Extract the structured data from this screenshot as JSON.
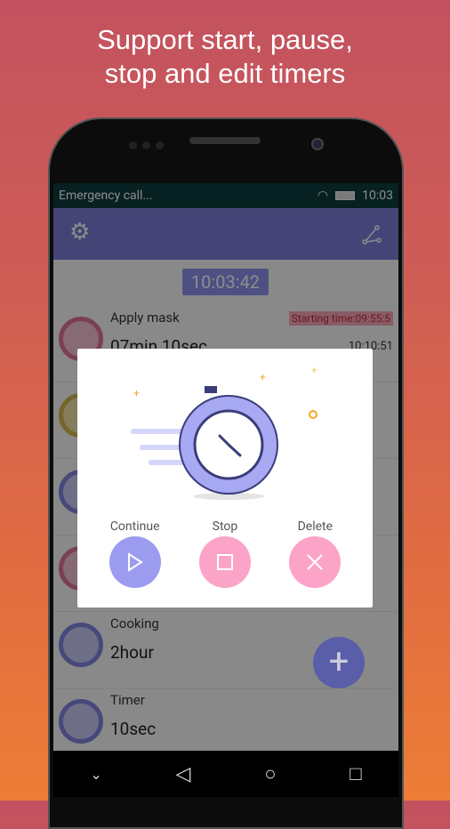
{
  "headline": {
    "line1": "Support start, pause,",
    "line2": "stop and edit timers"
  },
  "status": {
    "left": "Emergency call...",
    "time": "10:03"
  },
  "appbar": {
    "left_icon": "gear-icon",
    "right_icon": "share-icon"
  },
  "clock": "10:03:42",
  "timers": [
    {
      "name": "Apply mask",
      "duration": "07min 10sec",
      "start": "Starting time:09:55:5",
      "end": "10:10:51",
      "state": "running",
      "color": "pink"
    },
    {
      "name": "",
      "duration": "",
      "state": "idle",
      "color": "yellow"
    },
    {
      "name": "",
      "duration": "",
      "state": "idle",
      "color": "purple"
    },
    {
      "name": "",
      "duration": "",
      "state": "running",
      "color": "pink"
    },
    {
      "name": "Cooking",
      "duration": "2hour",
      "state": "idle",
      "color": "purple"
    },
    {
      "name": "Timer",
      "duration": "10sec",
      "state": "idle",
      "color": "purple"
    }
  ],
  "dialog": {
    "actions": [
      {
        "label": "Continue",
        "icon": "play-icon",
        "color": "#9b9cf0"
      },
      {
        "label": "Stop",
        "icon": "stop-icon",
        "color": "#fca4c8"
      },
      {
        "label": "Delete",
        "icon": "close-icon",
        "color": "#fca4c8"
      }
    ]
  },
  "colors": {
    "accent": "#7c7fd8",
    "pink": "#fca4c8"
  }
}
